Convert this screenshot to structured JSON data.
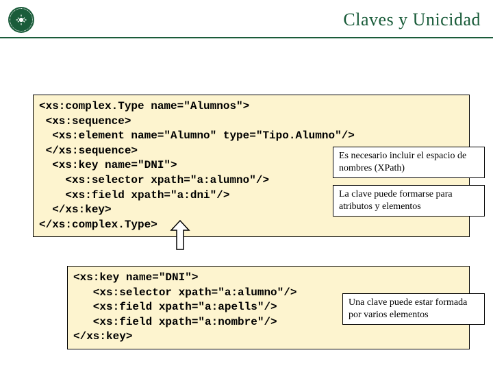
{
  "title": "Claves y Unicidad",
  "code1": "<xs:complex.Type name=\"Alumnos\">\n <xs:sequence>\n  <xs:element name=\"Alumno\" type=\"Tipo.Alumno\"/>\n </xs:sequence>\n  <xs:key name=\"DNI\">\n    <xs:selector xpath=\"a:alumno\"/>\n    <xs:field xpath=\"a:dni\"/>\n  </xs:key>\n</xs:complex.Type>",
  "code2": "<xs:key name=\"DNI\">\n   <xs:selector xpath=\"a:alumno\"/>\n   <xs:field xpath=\"a:apells\"/>\n   <xs:field xpath=\"a:nombre\"/>\n</xs:key>",
  "note1": "Es necesario incluir el espacio de nombres (XPath)",
  "note2": "La clave puede formarse para atributos y elementos",
  "note3": "Una clave puede estar formada por varios elementos"
}
